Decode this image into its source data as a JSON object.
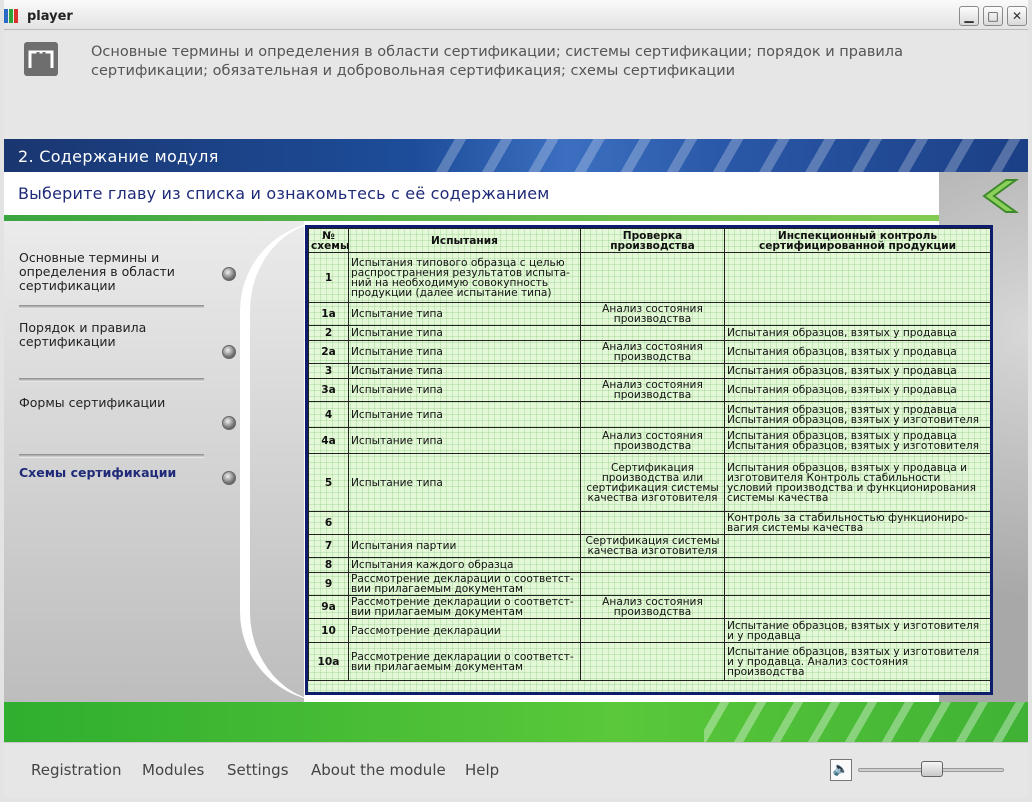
{
  "window": {
    "title": "player",
    "controls": {
      "minimize": "minimize-icon",
      "maximize": "maximize-icon",
      "close": "close-icon"
    }
  },
  "header": {
    "logo": "film-logo-icon",
    "title": "Основные термины и определения в области сертификации; системы сертификации; порядок и правила сертификации; обязательная и добровольная сертификация; схемы сертификации"
  },
  "section": {
    "title": "2. Содержание модуля",
    "subtitle": "Выберите главу из списка и ознакомьтесь с её содержанием",
    "back_icon": "back-arrow-icon"
  },
  "chapters": [
    {
      "label": "Основные термины и определения в области сертификации",
      "active": false
    },
    {
      "label": "Порядок и правила сертификации",
      "active": false
    },
    {
      "label": "Формы сертификации",
      "active": false
    },
    {
      "label": "Схемы сертификации",
      "active": true
    }
  ],
  "table": {
    "headers": [
      "№ схемы",
      "Испытания",
      "Проверка производства",
      "Инспекционный контроль сертифицированной продукции"
    ],
    "rows": [
      [
        "1",
        "Испытания типового образца с целью распространения результатов испыта-ний на необходимую совокупность продукции (далее испытание типа)",
        "",
        ""
      ],
      [
        "1а",
        "Испытание типа",
        "Анализ состояния производства",
        ""
      ],
      [
        "2",
        "Испытание типа",
        "",
        "Испытания образцов, взятых у продавца"
      ],
      [
        "2а",
        "Испытание типа",
        "Анализ состояния производства",
        "Испытания образцов, взятых у продавца"
      ],
      [
        "3",
        "Испытание типа",
        "",
        "Испытания образцов, взятых у продавца"
      ],
      [
        "3а",
        "Испытание типа",
        "Анализ состояния производства",
        "Испытания образцов, взятых у продавца"
      ],
      [
        "4",
        "Испытание типа",
        "",
        "Испытания образцов, взятых у продавца Испытания образцов, взятых у изготовителя"
      ],
      [
        "4а",
        "Испытание типа",
        "Анализ состояния производства",
        "Испытания образцов, взятых у продавца Испытания образцов, взятых у изготовителя"
      ],
      [
        "5",
        "Испытание типа",
        "Сертификация производства или сертификация системы качества изготовителя",
        "Испытания образцов, взятых у продавца и изготовителя Контроль стабильности условий производства и функционирования системы качества"
      ],
      [
        "6",
        "",
        "",
        "Контроль за стабильностью функциониро-вагия системы качества"
      ],
      [
        "7",
        "Испытания партии",
        "Сертификация системы качества изготовителя",
        ""
      ],
      [
        "8",
        "Испытания каждого образца",
        "",
        ""
      ],
      [
        "9",
        "Рассмотрение декларации о соответст-вии прилагаемым документам",
        "",
        ""
      ],
      [
        "9а",
        "Рассмотрение декларации о соответст-вии прилагаемым документам",
        "Анализ состояния производства",
        ""
      ],
      [
        "10",
        "Рассмотрение декларации",
        "",
        "Испытание образцов, взятых у изготовителя и у продавца"
      ],
      [
        "10а",
        "Рассмотрение декларации о соответст-вии прилагаемым документам",
        "",
        "Испытание образцов, взятых у изготовителя и у продавца. Анализ состояния производства"
      ]
    ]
  },
  "footer": {
    "links": [
      "Registration",
      "Modules",
      "Settings",
      "About the module",
      "Help"
    ],
    "speaker_icon": "speaker-icon",
    "volume": 0.5
  }
}
